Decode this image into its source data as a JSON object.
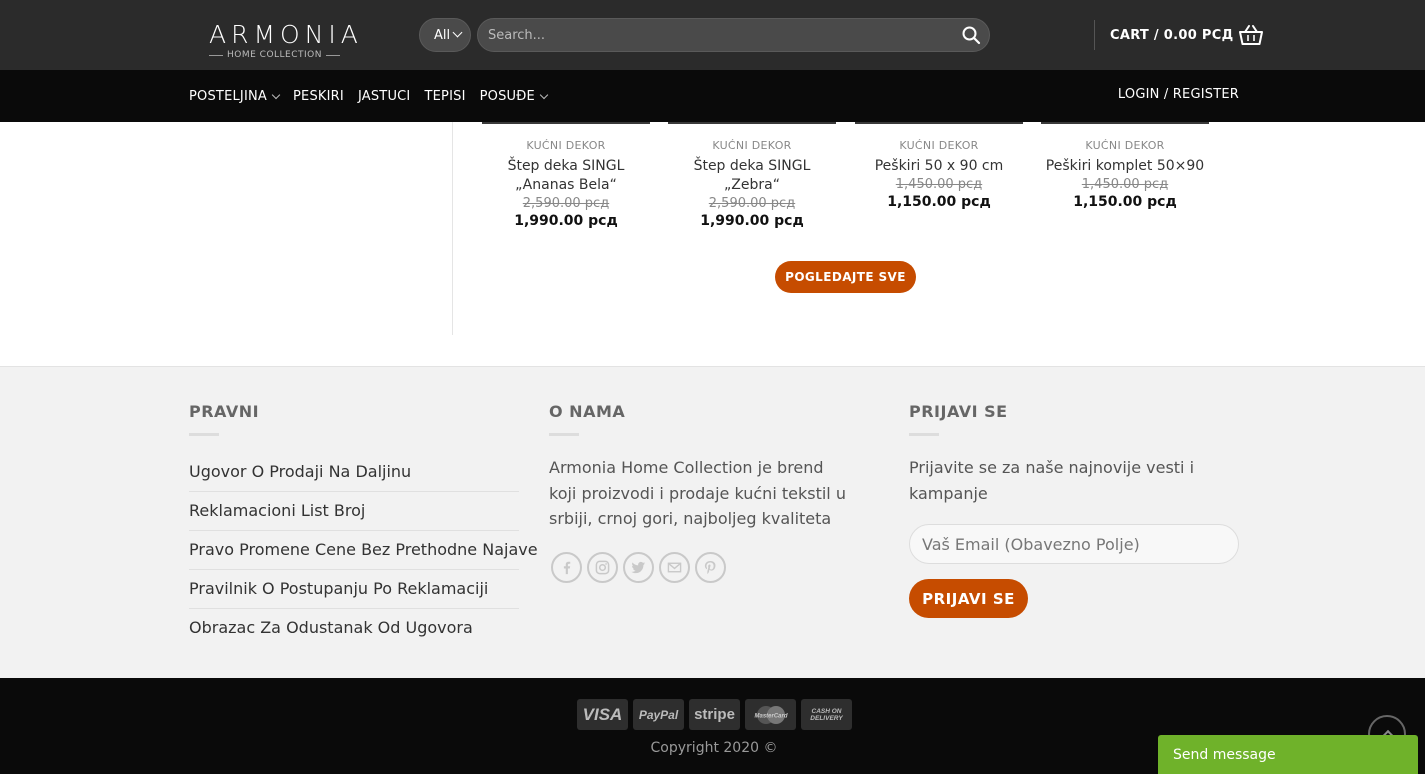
{
  "header": {
    "logo_main": "ARMONIA",
    "logo_sub": "HOME COLLECTION",
    "category_select": "All",
    "search_placeholder": "Search...",
    "cart_label": "CART / 0.00 РСД"
  },
  "nav": {
    "items": [
      {
        "label": "POSTELJINA",
        "has_dropdown": true
      },
      {
        "label": "PESKIRI",
        "has_dropdown": false
      },
      {
        "label": "JASTUCI",
        "has_dropdown": false
      },
      {
        "label": "TEPISI",
        "has_dropdown": false
      },
      {
        "label": "POSUĐE",
        "has_dropdown": true
      }
    ],
    "login_label": "LOGIN / REGISTER"
  },
  "products": [
    {
      "category": "KUĆNI DEKOR",
      "name": "Štep deka SINGL „Ananas Bela“",
      "old_price": "2,590.00 рсд",
      "price": "1,990.00 рсд"
    },
    {
      "category": "KUĆNI DEKOR",
      "name": "Štep deka SINGL „Zebra“",
      "old_price": "2,590.00 рсд",
      "price": "1,990.00 рсд"
    },
    {
      "category": "KUĆNI DEKOR",
      "name": "Peškiri 50 x 90 cm",
      "old_price": "1,450.00 рсд",
      "price": "1,150.00 рсд"
    },
    {
      "category": "KUĆNI DEKOR",
      "name": "Peškiri komplet 50×90",
      "old_price": "1,450.00 рсд",
      "price": "1,150.00 рсд"
    }
  ],
  "view_all_label": "POGLEDAJTE SVE",
  "footer": {
    "legal": {
      "title": "PRAVNI",
      "links": [
        "Ugovor O Prodaji Na Daljinu",
        "Reklamacioni List Broj",
        "Pravo Promene Cene Bez Prethodne Najave",
        "Pravilnik O Postupanju Po Reklamaciji",
        "Obrazac Za Odustanak Od Ugovora"
      ]
    },
    "about": {
      "title": "O NAMA",
      "text": "Armonia Home Collection je brend koji proizvodi i prodaje kućni tekstil u srbiji, crnoj gori, najboljeg kvaliteta",
      "socials": [
        "facebook-icon",
        "instagram-icon",
        "twitter-icon",
        "email-icon",
        "pinterest-icon"
      ]
    },
    "newsletter": {
      "title": "PRIJAVI SE",
      "text": "Prijavite se za naše najnovije vesti i kampanje",
      "email_placeholder": "Vaš Email (Obavezno Polje)",
      "button_label": "PRIJAVI SE"
    }
  },
  "bottom": {
    "payments": [
      "VISA",
      "PayPal",
      "stripe",
      "MasterCard",
      "CASH ON DELIVERY"
    ],
    "copyright": "Copyright 2020 ©"
  },
  "chat": {
    "label": "Send message"
  },
  "colors": {
    "accent": "#c64c00",
    "header": "#2b2b2b",
    "nav": "#0a0a0a",
    "chat": "#6fb22a",
    "footer": "#f2f2f2"
  }
}
